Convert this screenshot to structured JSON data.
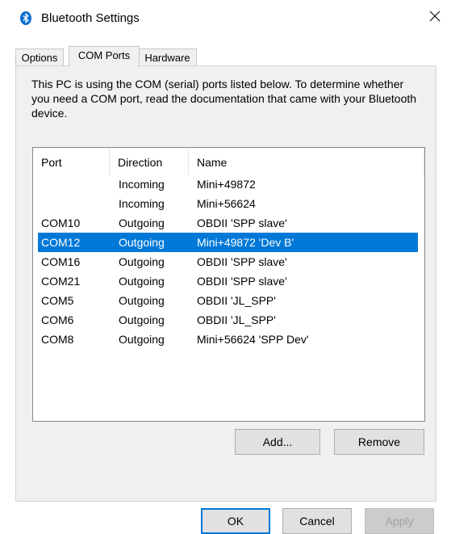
{
  "window": {
    "title": "Bluetooth Settings"
  },
  "tabs": [
    {
      "label": "Options"
    },
    {
      "label": "COM Ports"
    },
    {
      "label": "Hardware"
    }
  ],
  "description": "This PC is using the COM (serial) ports listed below. To determine whether you need a COM port, read the documentation that came with your Bluetooth device.",
  "ports": {
    "columns": [
      "Port",
      "Direction",
      "Name"
    ],
    "rows": [
      {
        "port": "",
        "direction": "Incoming",
        "name": "Mini+49872"
      },
      {
        "port": "",
        "direction": "Incoming",
        "name": "Mini+56624"
      },
      {
        "port": "COM10",
        "direction": "Outgoing",
        "name": "OBDII 'SPP slave'"
      },
      {
        "port": "COM12",
        "direction": "Outgoing",
        "name": "Mini+49872 'Dev B'"
      },
      {
        "port": "COM16",
        "direction": "Outgoing",
        "name": "OBDII 'SPP slave'"
      },
      {
        "port": "COM21",
        "direction": "Outgoing",
        "name": "OBDII 'SPP slave'"
      },
      {
        "port": "COM5",
        "direction": "Outgoing",
        "name": "OBDII 'JL_SPP'"
      },
      {
        "port": "COM6",
        "direction": "Outgoing",
        "name": "OBDII 'JL_SPP'"
      },
      {
        "port": "COM8",
        "direction": "Outgoing",
        "name": "Mini+56624 'SPP Dev'"
      }
    ]
  },
  "buttons": {
    "add": "Add...",
    "remove": "Remove",
    "ok": "OK",
    "cancel": "Cancel",
    "apply": "Apply"
  },
  "icons": {
    "title": "bluetooth-icon",
    "close": "close-icon"
  },
  "colors": {
    "selection": "#0078d7",
    "bluetooth": "#0a6ed1"
  }
}
